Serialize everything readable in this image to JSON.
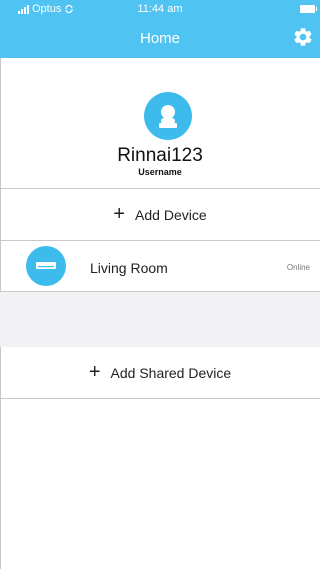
{
  "status_bar": {
    "carrier": "Optus",
    "time": "11:44 am"
  },
  "header": {
    "title": "Home",
    "settings_icon": "gear-icon"
  },
  "profile": {
    "avatar_icon": "person-icon",
    "username": "Rinnai123",
    "username_label": "Username"
  },
  "add_device": {
    "icon": "plus-icon",
    "label": "Add Device"
  },
  "devices": [
    {
      "icon": "air-conditioner-icon",
      "name": "Living Room",
      "status": "Online"
    }
  ],
  "add_shared_device": {
    "icon": "plus-icon",
    "label": "Add Shared Device"
  },
  "colors": {
    "accent": "#4fc3f1",
    "icon_circle": "#3dbbec"
  }
}
